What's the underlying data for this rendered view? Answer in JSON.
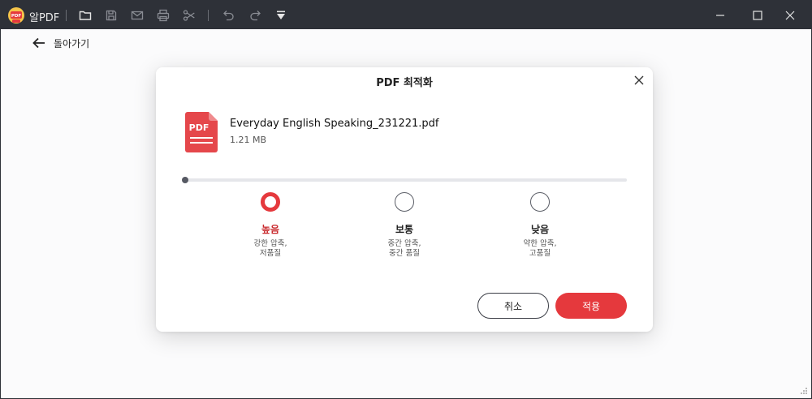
{
  "app": {
    "title": "알PDF"
  },
  "toolbar": {
    "icons": [
      "open-folder-icon",
      "save-icon",
      "mail-icon",
      "print-icon",
      "scissors-icon",
      "undo-icon",
      "redo-icon",
      "dropdown-menu-icon"
    ]
  },
  "window_controls": [
    "minimize-icon",
    "maximize-icon",
    "close-icon"
  ],
  "back": {
    "label": "돌아가기"
  },
  "dialog": {
    "title": "PDF 최적화",
    "file": {
      "icon_label": "PDF",
      "name": "Everyday English Speaking_231221.pdf",
      "size": "1.21 MB"
    },
    "options": [
      {
        "name": "높음",
        "desc_line1": "강한 압축,",
        "desc_line2": "저품질",
        "selected": true
      },
      {
        "name": "보통",
        "desc_line1": "중간 압축,",
        "desc_line2": "중간 품질",
        "selected": false
      },
      {
        "name": "낮음",
        "desc_line1": "약한 압축,",
        "desc_line2": "고품질",
        "selected": false
      }
    ],
    "cancel_label": "취소",
    "apply_label": "적용"
  },
  "colors": {
    "titlebar": "#2e3138",
    "accent": "#e5393d",
    "selected_text": "#c8282c",
    "background": "#fbfbfc"
  }
}
